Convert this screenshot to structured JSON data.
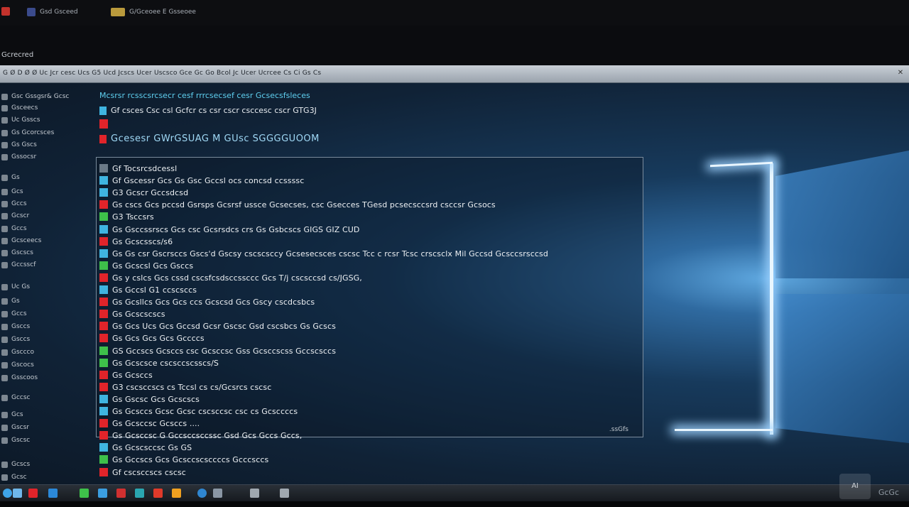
{
  "topbar": {
    "items": [
      {
        "label": "Gsd  Gsceed",
        "icon": "app-icon",
        "color": "#3b4b8c"
      },
      {
        "label": "G/Gceoee  E  Gsseoee",
        "icon": "folder-icon",
        "color": "#b99a3c"
      }
    ],
    "corner_color": "#c3322c"
  },
  "app_caption": "Gcrecred",
  "menubar": {
    "text": "G  Ø  D  Ø  Ø  Uc  Jcr  cesc  Ucs  G5  Ucd  Jcscs  Ucer  Uscsco  Gce  Gc  Go  Bcol  Jc  Ucer  Ucrcee  Cs  Ci  Gs  Cs",
    "close_icon": "✕"
  },
  "sidebar": {
    "items": [
      {
        "label": "Gsc  Gssgsr&  Gcsc",
        "icon": "folder-icon"
      },
      {
        "label": "Gsceecs",
        "icon": "doc-icon"
      },
      {
        "label": "Uc  Gsscs",
        "icon": "doc-icon"
      },
      {
        "label": "Gs  Gcorcsces",
        "icon": "doc-icon"
      },
      {
        "label": "Gs  Gscs",
        "icon": "doc-icon"
      },
      {
        "label": "Gssocsr",
        "icon": "folder-icon"
      },
      {
        "label": "Gs",
        "icon": "dot-icon"
      },
      {
        "label": "Gcs",
        "icon": "doc-icon"
      },
      {
        "label": "Gccs",
        "icon": "doc-icon"
      },
      {
        "label": "Gcscr",
        "icon": "doc-icon"
      },
      {
        "label": "Gccs",
        "icon": "doc-icon"
      },
      {
        "label": "Gcsceecs",
        "icon": "doc-icon"
      },
      {
        "label": "Gscscs",
        "icon": "doc-icon"
      },
      {
        "label": "Gccsscf",
        "icon": "doc-icon"
      },
      {
        "label": "Uc  Gs",
        "icon": "dot-icon"
      },
      {
        "label": "Gs",
        "icon": "dot-icon"
      },
      {
        "label": "Gccs",
        "icon": "doc-icon"
      },
      {
        "label": "Gsccs",
        "icon": "doc-icon"
      },
      {
        "label": "Gsccs",
        "icon": "doc-icon"
      },
      {
        "label": "Gsccco",
        "icon": "dot-icon"
      },
      {
        "label": "Gscocs",
        "icon": "dot-icon"
      },
      {
        "label": "Gsscoos",
        "icon": "dot-icon"
      },
      {
        "label": "Gccsc",
        "icon": "dot-icon"
      },
      {
        "label": "Gcs",
        "icon": "dot-icon"
      },
      {
        "label": "Gscsr",
        "icon": "dot-icon"
      },
      {
        "label": "Gscsc",
        "icon": "dot-icon"
      },
      {
        "label": "Gcscs",
        "icon": "dot-icon"
      },
      {
        "label": "Gcsc",
        "icon": "dot-icon"
      }
    ]
  },
  "header": {
    "line1": "Mcsrsr  rcsscsrcsecr  cesf  rrrcsecsef  cesr  Gcsecsfsleces",
    "line2": "Gf  csces  Csc  csl  Gcfcr  cs  csr  cscr  csccesc  cscr  GTG3J",
    "heading": "Gcesesr  GWrGSUAG  M  GUsc  SGGGGUOOM"
  },
  "list": {
    "tag": ".ssGfs",
    "rows": [
      {
        "text": "Gf  Tocsrcsdcessl",
        "marker": "#6b7a88"
      },
      {
        "text": "Gf  Gscessr  Gcs  Gs  Gsc  Gccsl  ocs  concsd  ccssssc",
        "marker": "#3fb4e0"
      },
      {
        "text": "G3  Gcscr  Gccsdcsd",
        "marker": "#3fb4e0"
      },
      {
        "text": "Gs  cscs  Gcs  pccsd  Gsrsps  Gcsrsf  ussce  Gcsecses,  csc  Gsecces  TGesd  pcsecsccsrd  csccsr  Gcsocs",
        "marker": "#e0242a"
      },
      {
        "text": "G3  Tsccsrs",
        "marker": "#3ec04a"
      },
      {
        "text": "Gs  Gsccssrscs  Gcs  csc  Gcsrsdcs  crs  Gs  Gsbcscs  GIGS  GIZ  CUD",
        "marker": "#3fb4e0"
      },
      {
        "text": "Gs  Gcscsscs/s6",
        "marker": "#e0242a"
      },
      {
        "text": "Gs  Gs  csr  Gscrsccs  Gscs'd  Gscsy  cscscsccy  Gcsesecsces  cscsc  Tcc  c  rcsr  Tcsc  crscsclx  Mil  Gccsd  Gcsccsrsccsd",
        "marker": "#3fb4e0"
      },
      {
        "text": "Gs  Gcscsl  Gcs  Gsccs",
        "marker": "#3ec04a"
      },
      {
        "text": "Gs  y  cslcs  Gcs  cssd  cscsfcsdsccssccc  Gcs  T/j  cscsccsd  cs/JGSG,",
        "marker": "#e0242a"
      },
      {
        "text": "Gs  Gccsl  G1  ccscsccs",
        "marker": "#3fb4e0"
      },
      {
        "text": "Gs  Gcsllcs  Gcs  Gcs  ccs  Gcscsd  Gcs  Gscy  cscdcsbcs",
        "marker": "#e0242a"
      },
      {
        "text": "Gs  Gcscscscs",
        "marker": "#e0242a"
      },
      {
        "text": "Gs  Gcs  Ucs  Gcs  Gccsd  Gcsr  Gscsc  Gsd  cscsbcs  Gs  Gcscs",
        "marker": "#e0242a"
      },
      {
        "text": "Gs  Gcs  Gcs  Gcs  Gccccs",
        "marker": "#e0242a"
      },
      {
        "text": "GS  Gccscs  Gcsccs  csc  Gcsccsc  Gss  Gcsccscss  Gccscsccs",
        "marker": "#3ec04a"
      },
      {
        "text": "Gs  Gcscsce  cscsccscsscs/S",
        "marker": "#3ec04a"
      },
      {
        "text": "Gs  Gcsccs",
        "marker": "#e0242a"
      },
      {
        "text": "G3  cscsccscs  cs  Tccsl  cs  cs/Gcsrcs  cscsc",
        "marker": "#e0242a"
      },
      {
        "text": "Gs  Gscsc  Gcs  Gcscscs",
        "marker": "#3fb4e0"
      },
      {
        "text": "Gs  Gcsccs  Gcsc  Gcsc  cscsccsc  csc  cs  Gcsccccs",
        "marker": "#3fb4e0"
      },
      {
        "text": "Gs  Gcsccsc  Gcsccs  ....",
        "marker": "#e0242a"
      },
      {
        "text": "Gs  Gcsccsc  G  Gccsccsccssc  Gsd  Gcs  Gccs  Gccs,",
        "marker": "#e0242a"
      },
      {
        "text": "Gs  Gcscsccsc  Gs  GS",
        "marker": "#3fb4e0"
      },
      {
        "text": "Gs  Gccscs  Gcs  Gcsccscsccccs  Gcccsccs",
        "marker": "#3ec04a"
      },
      {
        "text": "Gf  cscsccscs  cscsc",
        "marker": "#e0242a"
      }
    ]
  },
  "taskbar": {
    "icons": [
      {
        "name": "start-icon",
        "color": "#3fa3e6"
      },
      {
        "name": "search-icon",
        "color": "#6fb7ea"
      },
      {
        "name": "app-red-icon",
        "color": "#e0242a"
      },
      {
        "name": "app-blue-icon",
        "color": "#2b88d8"
      },
      {
        "name": "app-green-icon",
        "color": "#3ec04a"
      },
      {
        "name": "edge-icon",
        "color": "#3b9ee0"
      },
      {
        "name": "app-red2-icon",
        "color": "#d03030"
      },
      {
        "name": "app-teal-icon",
        "color": "#2aa6b0"
      },
      {
        "name": "app-red3-icon",
        "color": "#e03a2a"
      },
      {
        "name": "app-orange-icon",
        "color": "#f0a020"
      },
      {
        "name": "globe-icon",
        "color": "#2f86d0"
      },
      {
        "name": "app-gray-icon",
        "color": "#8a96a4"
      },
      {
        "name": "link-icon",
        "color": "#a0a8b0"
      },
      {
        "name": "arrow-icon",
        "color": "#a0a8b0"
      }
    ],
    "tray_badge": "AI",
    "tray_text": "GcGc"
  }
}
